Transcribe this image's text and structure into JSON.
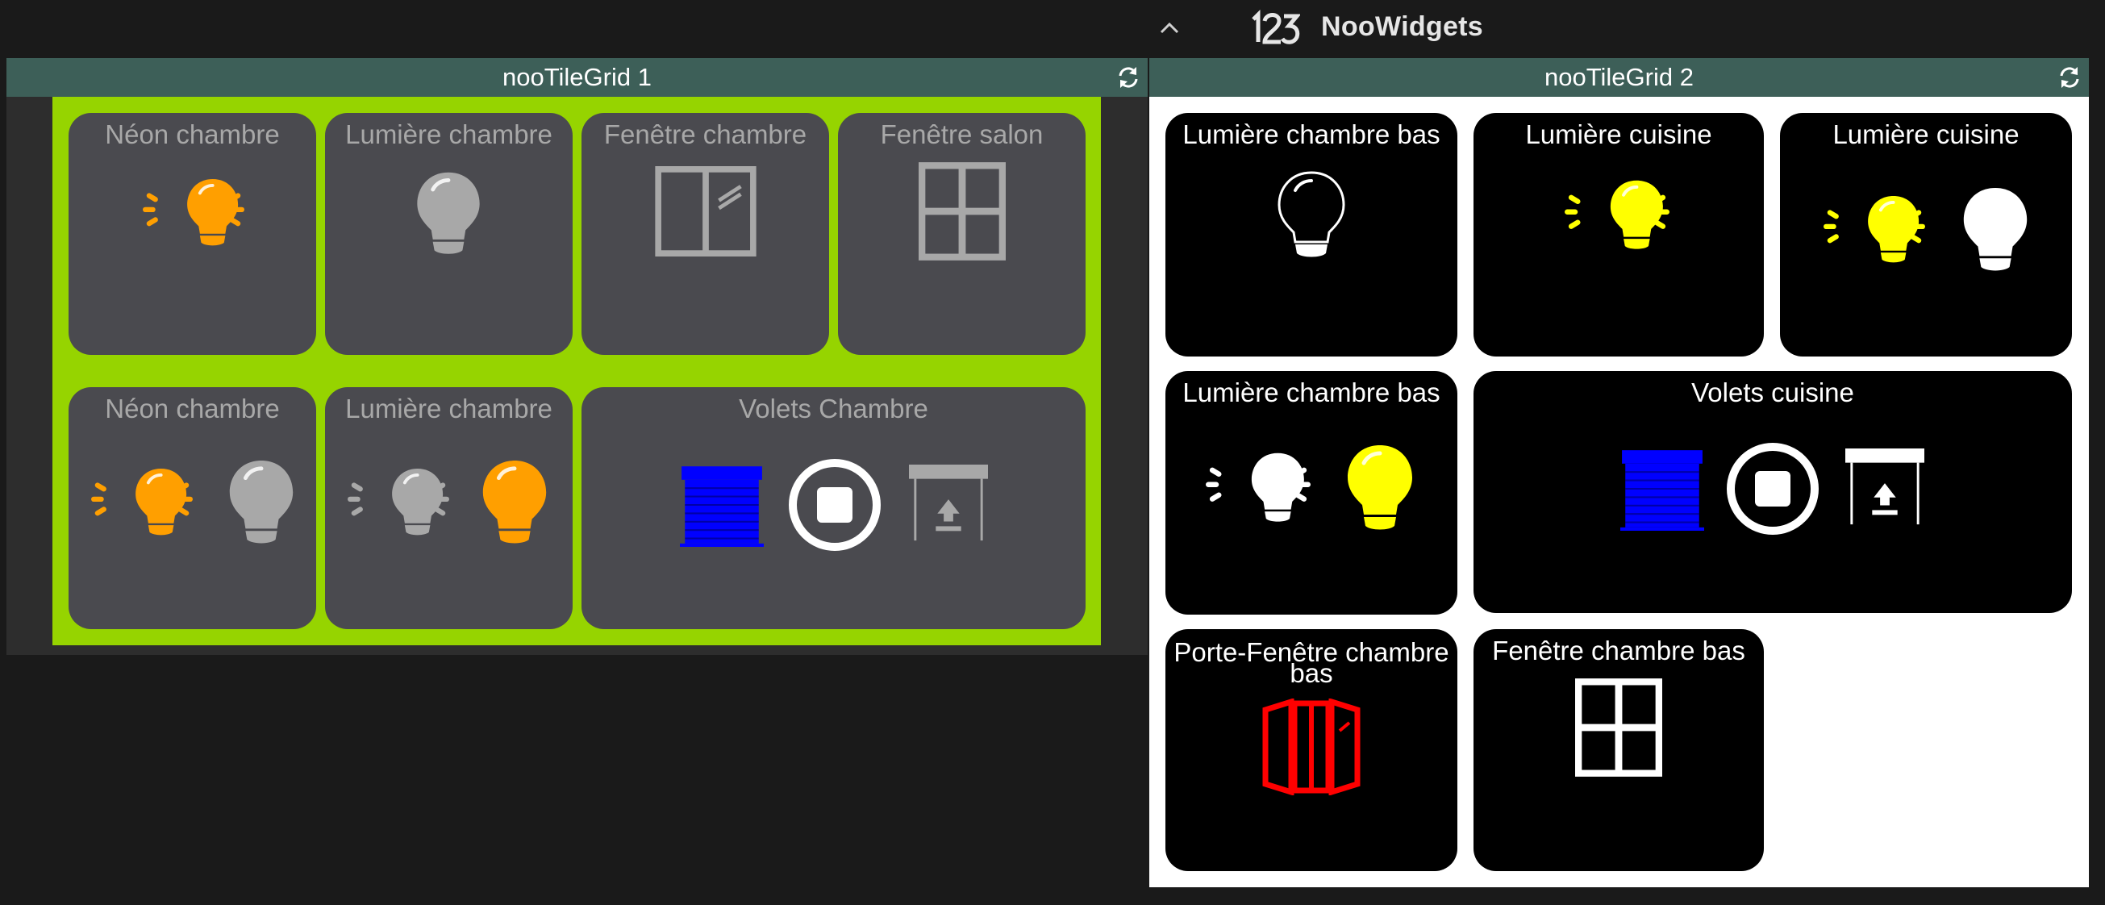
{
  "app": {
    "title": "NooWidgets",
    "logo_icon": "123-logo-icon"
  },
  "header": {
    "collapse_icon": "chevron-up-icon"
  },
  "grid1": {
    "title": "nooTileGrid 1",
    "refresh_icon": "refresh-icon",
    "background_color": "#96d400",
    "tiles": [
      {
        "title": "Néon chambre",
        "icons": [
          "bulb-on-icon"
        ],
        "state_color": "#ff9f00"
      },
      {
        "title": "Lumière chambre",
        "icons": [
          "bulb-off-icon"
        ],
        "state_color": "#a8a8a8"
      },
      {
        "title": "Fenêtre chambre",
        "icons": [
          "window-double-icon"
        ],
        "state_color": "#a8a8a8"
      },
      {
        "title": "Fenêtre salon",
        "icons": [
          "window-four-pane-icon"
        ],
        "state_color": "#a8a8a8"
      },
      {
        "title": "Néon chambre",
        "icons": [
          "bulb-on-icon",
          "bulb-off-icon"
        ],
        "state_colors": [
          "#ff9f00",
          "#a8a8a8"
        ]
      },
      {
        "title": "Lumière chambre",
        "icons": [
          "bulb-on-icon",
          "bulb-off-icon"
        ],
        "state_colors": [
          "#a8a8a8",
          "#ff9f00"
        ]
      },
      {
        "title": "Volets Chambre",
        "icons": [
          "shutter-closed-icon",
          "stop-icon",
          "shutter-open-icon"
        ],
        "state_colors": [
          "#0000ff",
          "#ffffff",
          "#a8a8a8"
        ]
      }
    ]
  },
  "grid2": {
    "title": "nooTileGrid 2",
    "refresh_icon": "refresh-icon",
    "tiles": [
      {
        "title": "Lumière chambre bas",
        "icons": [
          "bulb-off-icon"
        ],
        "state_color": "#ffffff"
      },
      {
        "title": "Lumière cuisine",
        "icons": [
          "bulb-on-icon"
        ],
        "state_color": "#ffff00"
      },
      {
        "title": "Lumière cuisine",
        "icons": [
          "bulb-on-icon",
          "bulb-off-icon"
        ],
        "state_colors": [
          "#ffff00",
          "#ffffff"
        ]
      },
      {
        "title": "Lumière chambre bas",
        "icons": [
          "bulb-on-icon",
          "bulb-off-icon"
        ],
        "state_colors": [
          "#ffffff",
          "#ffff00"
        ]
      },
      {
        "title": "Volets cuisine",
        "icons": [
          "shutter-closed-icon",
          "stop-icon",
          "shutter-open-icon"
        ],
        "state_colors": [
          "#0000ff",
          "#ffffff",
          "#ffffff"
        ]
      },
      {
        "title": "Porte-Fenêtre chambre bas",
        "icons": [
          "french-door-open-icon"
        ],
        "state_color": "#ff0000"
      },
      {
        "title": "Fenêtre chambre bas",
        "icons": [
          "window-four-pane-icon"
        ],
        "state_color": "#ffffff"
      }
    ]
  }
}
